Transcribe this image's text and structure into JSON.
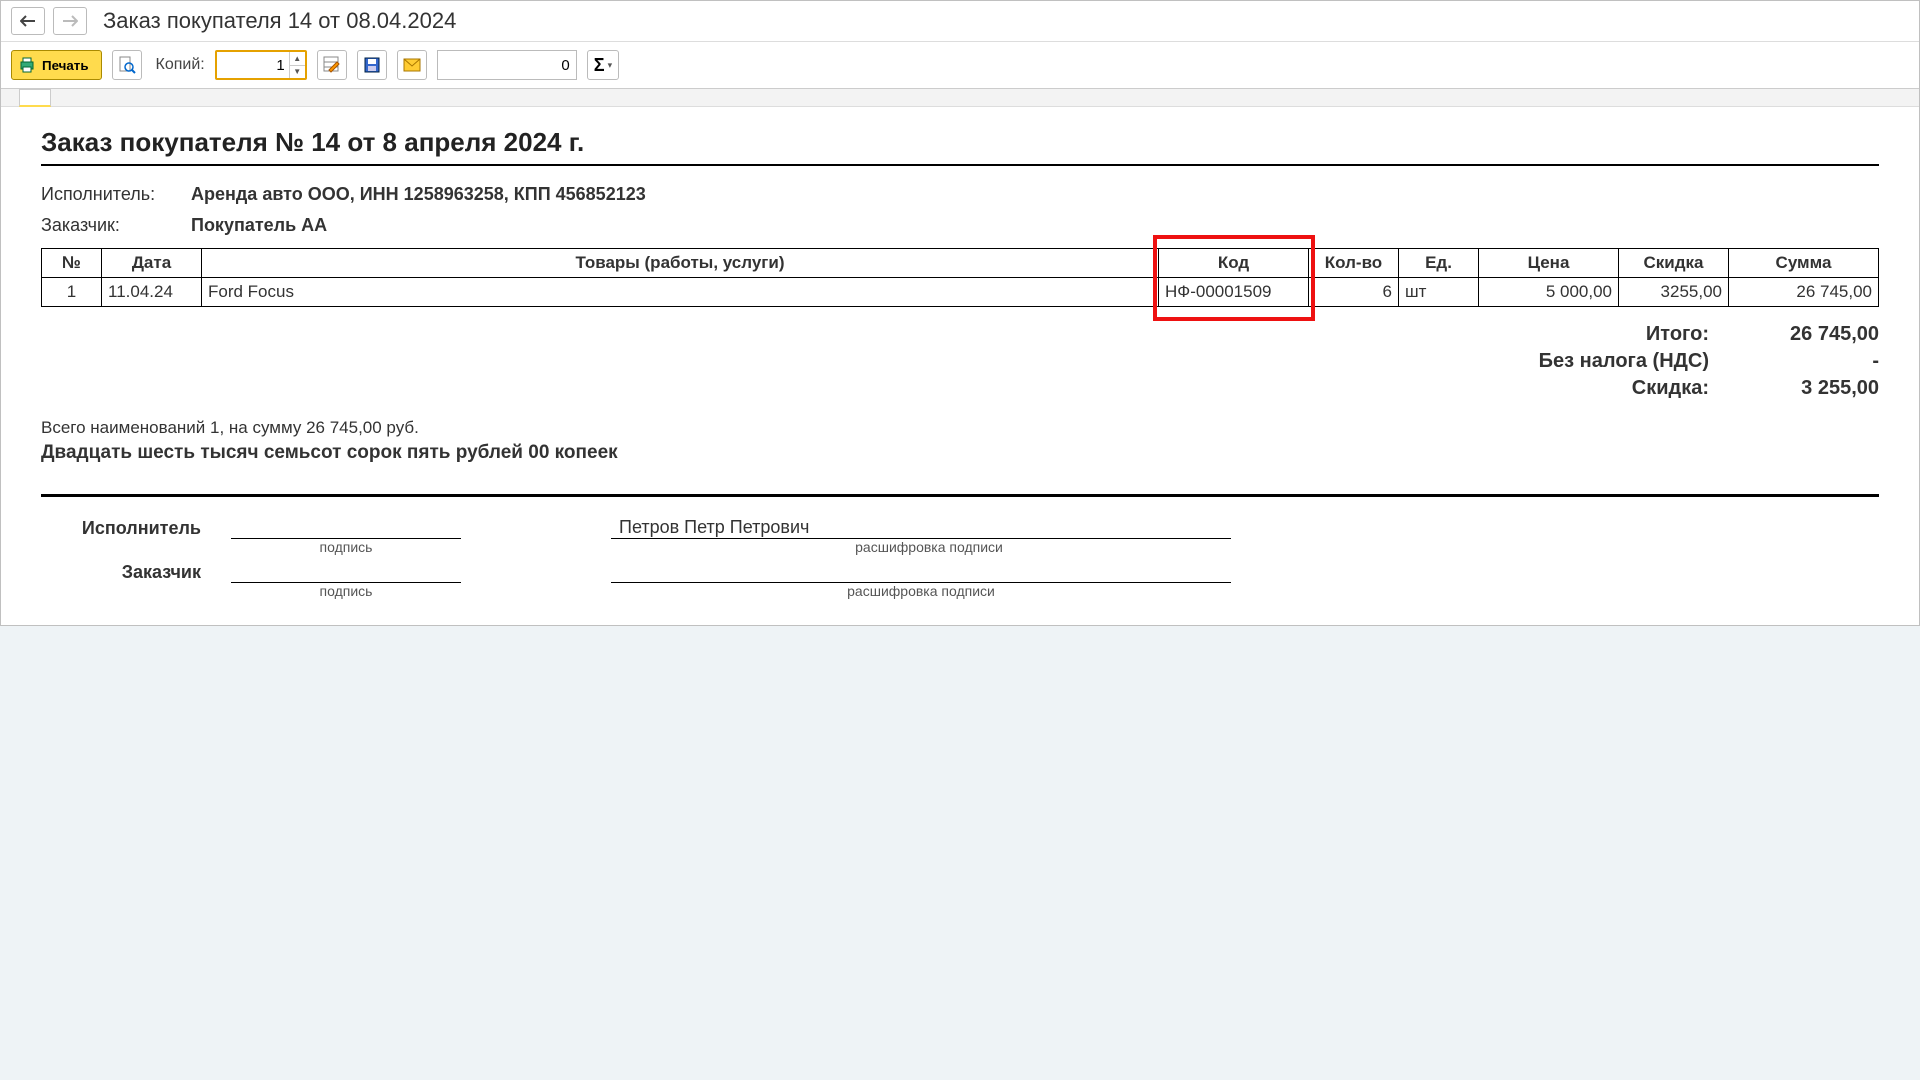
{
  "titlebar": {
    "title": "Заказ покупателя 14 от 08.04.2024"
  },
  "toolbar": {
    "print_label": "Печать",
    "copies_label": "Копий:",
    "copies_value": "1",
    "num_field_value": "0",
    "sigma_label": "Σ"
  },
  "document": {
    "title": "Заказ покупателя № 14 от 8 апреля 2024 г.",
    "executor_label": "Исполнитель:",
    "executor_value": "Аренда авто ООО, ИНН 1258963258, КПП 456852123",
    "customer_label": "Заказчик:",
    "customer_value": "Покупатель АА",
    "table": {
      "headers": {
        "num": "№",
        "date": "Дата",
        "goods": "Товары (работы, услуги)",
        "code": "Код",
        "qty": "Кол-во",
        "unit": "Ед.",
        "price": "Цена",
        "discount": "Скидка",
        "sum": "Сумма"
      },
      "rows": [
        {
          "num": "1",
          "date": "11.04.24",
          "goods": "Ford Focus",
          "code": "НФ-00001509",
          "qty": "6",
          "unit": "шт",
          "price": "5 000,00",
          "discount": "3255,00",
          "sum": "26 745,00"
        }
      ]
    },
    "totals": {
      "total_label": "Итого:",
      "total_value": "26 745,00",
      "vat_label": "Без налога (НДС)",
      "vat_value": "-",
      "discount_label": "Скидка:",
      "discount_value": "3 255,00"
    },
    "summary_line": "Всего наименований 1, на сумму 26 745,00 руб.",
    "summary_words": "Двадцать шесть тысяч семьсот сорок пять рублей 00 копеек",
    "signatures": {
      "executor_label": "Исполнитель",
      "executor_name": "Петров Петр Петрович",
      "customer_label": "Заказчик",
      "signature_caption": "подпись",
      "decipher_caption": "расшифровка подписи"
    }
  }
}
